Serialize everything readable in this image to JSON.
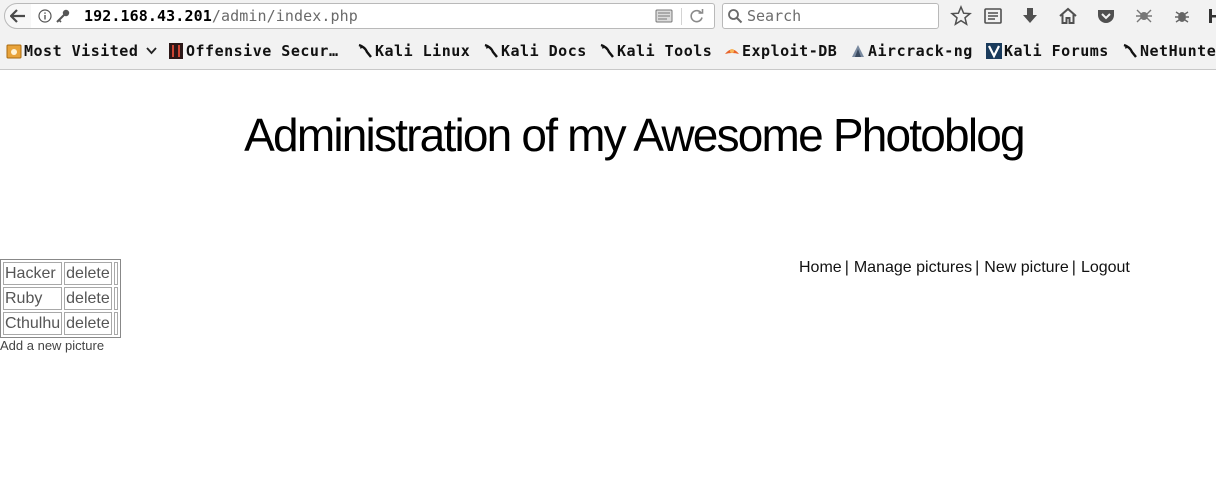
{
  "browser": {
    "url_host": "192.168.43.201",
    "url_path": "/admin/index.php",
    "search_placeholder": "Search",
    "bookmarks": [
      {
        "label": "Most Visited",
        "icon": "most-visited-icon"
      },
      {
        "label": "Offensive Secur…",
        "icon": "offsec-icon"
      },
      {
        "label": "Kali Linux",
        "icon": "kali-dragon-icon"
      },
      {
        "label": "Kali Docs",
        "icon": "kali-dragon-icon"
      },
      {
        "label": "Kali Tools",
        "icon": "kali-dragon-icon"
      },
      {
        "label": "Exploit-DB",
        "icon": "exploit-db-icon"
      },
      {
        "label": "Aircrack-ng",
        "icon": "aircrack-icon"
      },
      {
        "label": "Kali Forums",
        "icon": "kali-forums-icon"
      },
      {
        "label": "NetHunter",
        "icon": "kali-dragon-icon"
      }
    ]
  },
  "page": {
    "title": "Administration of my Awesome Photoblog",
    "nav": [
      {
        "label": "Home"
      },
      {
        "label": "Manage pictures"
      },
      {
        "label": "New picture"
      },
      {
        "label": "Logout"
      }
    ],
    "pictures": [
      {
        "name": "Hacker",
        "action": "delete"
      },
      {
        "name": "Ruby",
        "action": "delete"
      },
      {
        "name": "Cthulhu",
        "action": "delete"
      }
    ],
    "add_link": "Add a new picture"
  }
}
